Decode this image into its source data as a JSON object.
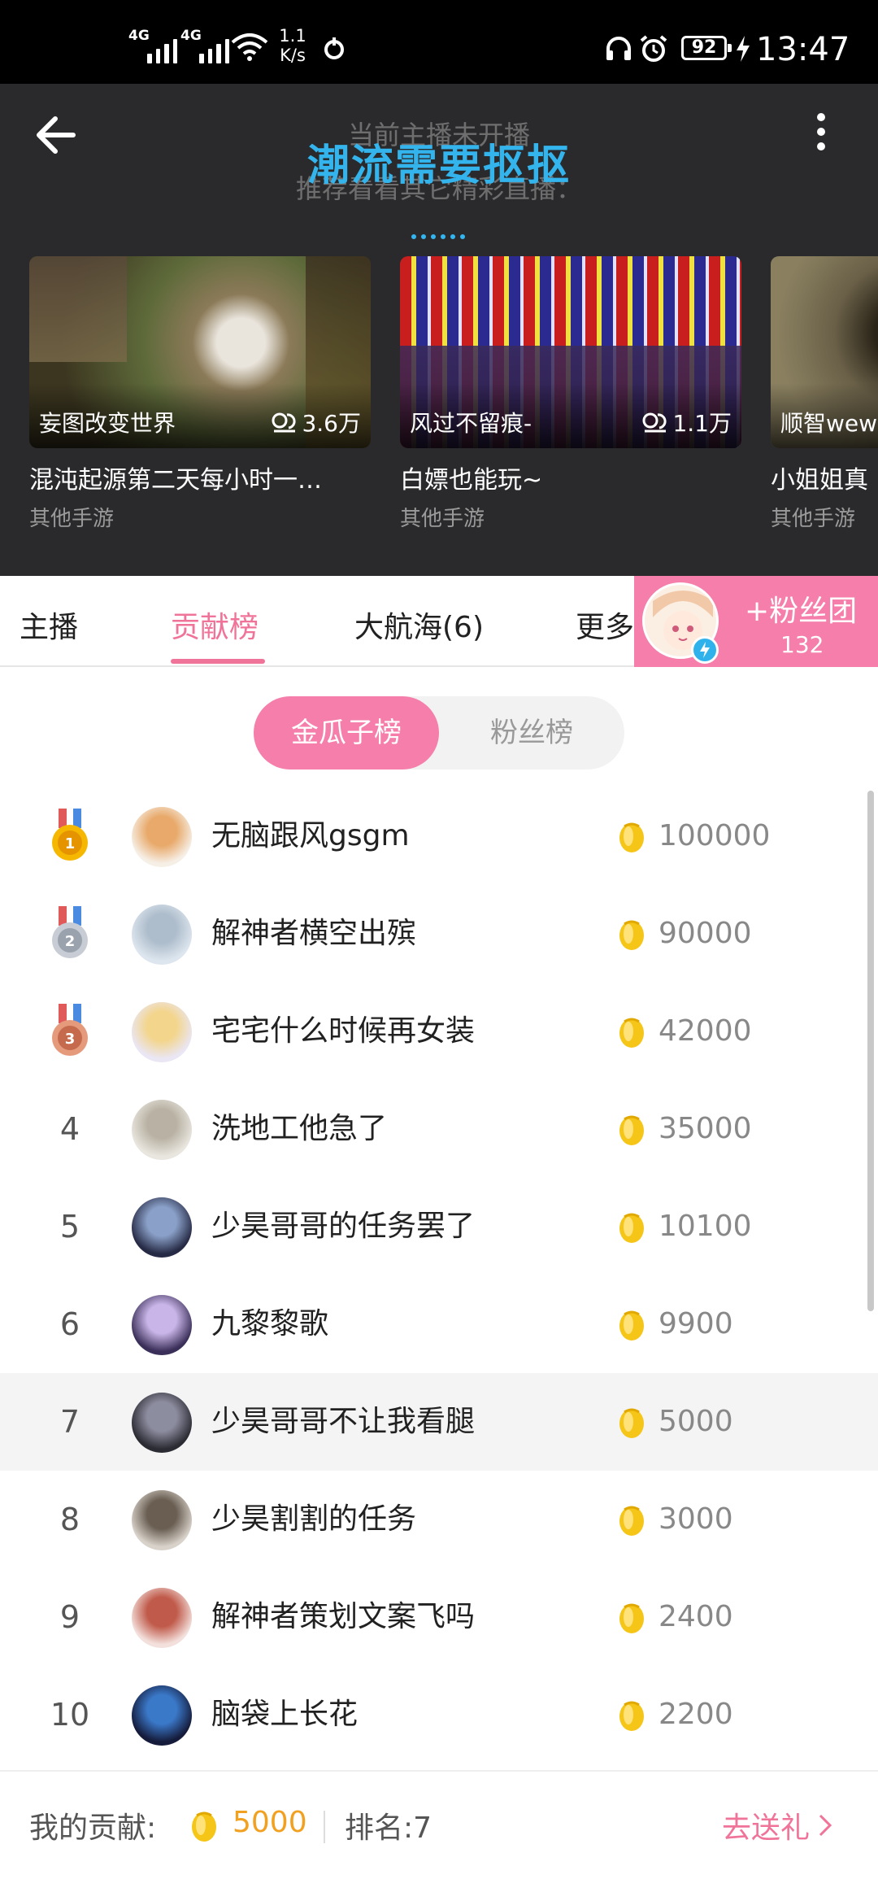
{
  "status_bar": {
    "network1": "4G",
    "network2": "4G",
    "speed_value": "1.1",
    "speed_unit": "K/s",
    "battery": "92",
    "time": "13:47"
  },
  "header": {
    "offline_line1": "当前主播未开播",
    "offline_line2": "推荐看看其它精彩直播：",
    "room_title": "潮流需要抠抠"
  },
  "recommendations": [
    {
      "streamer": "妄图改变世界",
      "viewers": "3.6万",
      "title": "混沌起源第二天每小时一…",
      "category": "其他手游"
    },
    {
      "streamer": "风过不留痕-",
      "viewers": "1.1万",
      "title": "白嫖也能玩~",
      "category": "其他手游"
    },
    {
      "streamer": "顺智wew",
      "viewers": "",
      "title": "小姐姐真",
      "category": "其他手游"
    }
  ],
  "tabs": [
    {
      "label": "主播",
      "active": false
    },
    {
      "label": "贡献榜",
      "active": true
    },
    {
      "label": "大航海(6)",
      "active": false
    },
    {
      "label": "更多",
      "active": false
    }
  ],
  "fan_club": {
    "join_label": "+粉丝团",
    "count": "132"
  },
  "segments": [
    {
      "label": "金瓜子榜",
      "active": true
    },
    {
      "label": "粉丝榜",
      "active": false
    }
  ],
  "ranking": [
    {
      "rank": "1",
      "name": "无脑跟风gsgm",
      "amount": "100000",
      "medal": "gold"
    },
    {
      "rank": "2",
      "name": "解神者横空出殡",
      "amount": "90000",
      "medal": "silver"
    },
    {
      "rank": "3",
      "name": "宅宅什么时候再女装",
      "amount": "42000",
      "medal": "bronze"
    },
    {
      "rank": "4",
      "name": "洗地工他急了",
      "amount": "35000"
    },
    {
      "rank": "5",
      "name": "少昊哥哥的任务罢了",
      "amount": "10100"
    },
    {
      "rank": "6",
      "name": "九黎黎歌",
      "amount": "9900"
    },
    {
      "rank": "7",
      "name": "少昊哥哥不让我看腿",
      "amount": "5000",
      "highlighted": true
    },
    {
      "rank": "8",
      "name": "少昊割割的任务",
      "amount": "3000"
    },
    {
      "rank": "9",
      "name": "解神者策划文案飞吗",
      "amount": "2400"
    },
    {
      "rank": "10",
      "name": "脑袋上长花",
      "amount": "2200"
    }
  ],
  "my_contribution": {
    "label": "我的贡献:",
    "amount": "5000",
    "rank_label": "排名:7",
    "send_gift": "去送礼"
  },
  "colors": {
    "accent_pink": "#f07399",
    "fan_club_bg": "#f57eaa",
    "title_blue": "#34b4ec",
    "coin_gold": "#f5c518"
  }
}
